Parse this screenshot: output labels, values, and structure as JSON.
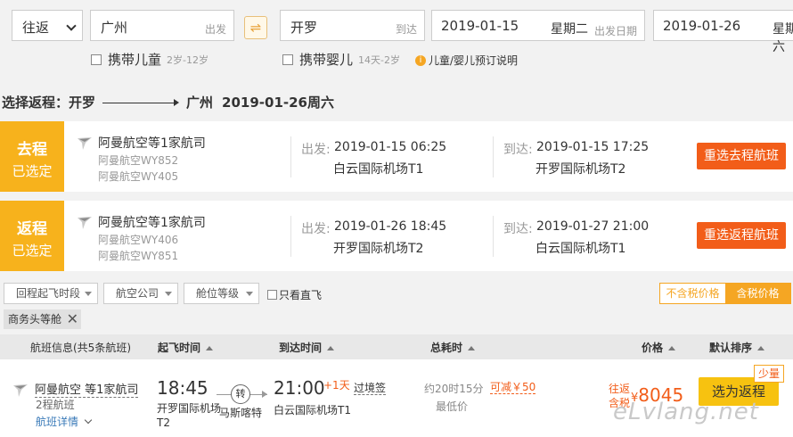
{
  "search": {
    "trip_type": "往返",
    "from_city": "广州",
    "from_hint": "出发",
    "to_city": "开罗",
    "to_hint": "到达",
    "swap_icon": "⇌",
    "depart_date": "2019-01-15",
    "depart_week": "星期二",
    "depart_hint": "出发日期",
    "return_date": "2019-01-26",
    "return_week": "星期六",
    "child_label": "携带儿童",
    "child_age": "2岁-12岁",
    "infant_label": "携带婴儿",
    "infant_age": "14天-2岁",
    "info_icon": "i",
    "info_text": "儿童/婴儿预订说明"
  },
  "selection": {
    "prefix": "选择返程：",
    "from": "开罗",
    "to": "广州",
    "date": "2019-01-26周六"
  },
  "legs": [
    {
      "badge_title": "去程",
      "badge_sub": "已选定",
      "airline": "阿曼航空等1家航司",
      "flight1": "阿曼航空WY852",
      "flight2": "阿曼航空WY405",
      "dep_label": "出发:",
      "dep_time": "2019-01-15 06:25",
      "dep_airport": "白云国际机场T1",
      "arr_label": "到达:",
      "arr_time": "2019-01-15 17:25",
      "arr_airport": "开罗国际机场T2",
      "button": "重选去程航班"
    },
    {
      "badge_title": "返程",
      "badge_sub": "已选定",
      "airline": "阿曼航空等1家航司",
      "flight1": "阿曼航空WY406",
      "flight2": "阿曼航空WY851",
      "dep_label": "出发:",
      "dep_time": "2019-01-26 18:45",
      "dep_airport": "开罗国际机场T2",
      "arr_label": "到达:",
      "arr_time": "2019-01-27 21:00",
      "arr_airport": "白云国际机场T1",
      "button": "重选返程航班"
    }
  ],
  "filters": {
    "time": "回程起飞时段",
    "airline": "航空公司",
    "cabin": "舱位等级",
    "direct_only": "只看直飞",
    "price_excl_tax": "不含税价格",
    "price_incl_tax": "含税价格",
    "active_tag": "商务头等舱",
    "tag_close": "✕"
  },
  "table_head": {
    "info": "航班信息(共5条航班)",
    "depart": "起飞时间",
    "arrive": "到达时间",
    "duration": "总耗时",
    "price": "价格",
    "sort": "默认排序"
  },
  "result": {
    "airline": "阿曼航空 等1家航司",
    "stops": "2程航班",
    "details": "航班详情",
    "dep_time": "18:45",
    "dep_airport": "开罗国际机场T2",
    "transfer": "转",
    "via": "马斯喀特",
    "arr_time": "21:00",
    "plus_day": "+1天",
    "border": "过境签",
    "arr_airport": "白云国际机场T1",
    "duration": "约20时15分",
    "lowest": "最低价",
    "saving": "可减￥50",
    "price_label_1": "往返",
    "price_label_2": "含税",
    "currency": "¥",
    "price": "8045",
    "book": "选为返程",
    "few_left": "少量"
  },
  "watermark": "eLvlang.net"
}
